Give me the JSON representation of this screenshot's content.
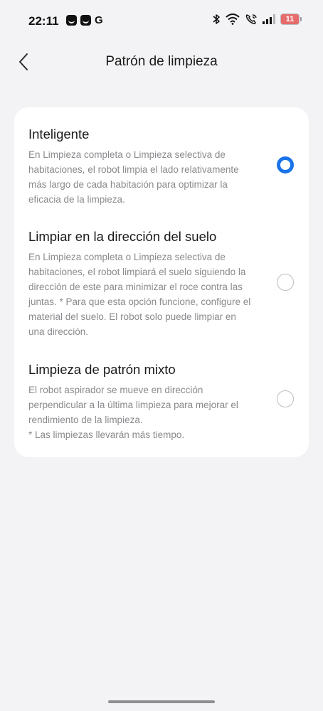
{
  "status_bar": {
    "time": "22:11",
    "notification_letter": "G",
    "battery_level": "11"
  },
  "header": {
    "title": "Patrón de limpieza"
  },
  "options": [
    {
      "title": "Inteligente",
      "description": "En Limpieza completa o Limpieza selectiva de habitaciones, el robot limpia el lado relativamente más largo de cada habitación para optimizar la eficacia de la limpieza.",
      "selected": true
    },
    {
      "title": "Limpiar en la dirección del suelo",
      "description": "En Limpieza completa o Limpieza selectiva de habitaciones, el robot limpiará el suelo siguiendo la dirección de este para minimizar el roce contra las juntas. * Para que esta opción funcione, configure el material del suelo. El robot solo puede limpiar en una dirección.",
      "selected": false
    },
    {
      "title": "Limpieza de patrón mixto",
      "description": "El robot aspirador se mueve en dirección perpendicular a la última limpieza para mejorar el rendimiento de la limpieza.\n* Las limpiezas llevarán más tiempo.",
      "selected": false
    }
  ],
  "colors": {
    "accent": "#1a73e8",
    "background": "#f3f3f5",
    "card": "#ffffff",
    "secondary_text": "#8a8a8e",
    "battery_low": "#e66b6b"
  },
  "icons": {
    "back": "chevron-left-icon",
    "bluetooth": "bluetooth-icon",
    "wifi": "wifi-icon",
    "call": "wifi-call-icon",
    "signal": "signal-icon",
    "battery": "battery-icon"
  }
}
